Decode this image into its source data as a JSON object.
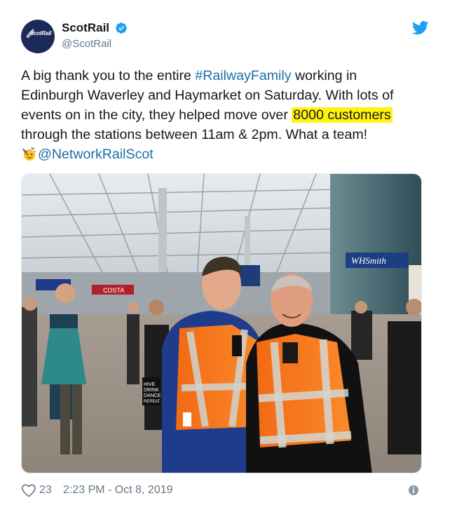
{
  "tweet": {
    "author": {
      "display_name": "ScotRail",
      "handle": "@ScotRail",
      "avatar_text": "ScotRail",
      "verified": true
    },
    "text": {
      "part1": "A big thank you to the entire ",
      "hashtag": "#RailwayFamily",
      "part2": " working in Edinburgh Waverley and Haymarket on Saturday. With lots of events on in the city, they helped move over ",
      "highlight": "8000 customers",
      "part3": " through the stations between 11am & 2pm. What a team! ",
      "mention": "@NetworkRailScot"
    },
    "photo": {
      "signs": {
        "shop": "WHSmith",
        "bag_line1": "HIVE",
        "bag_line2": "DRINK",
        "bag_line3": "DANCE",
        "bag_line4": "REPEAT",
        "costa": "COSTA"
      }
    },
    "footer": {
      "likes": "23",
      "timestamp": "2:23 PM - Oct 8, 2019"
    }
  },
  "colors": {
    "link": "#1b6fa8",
    "highlight": "#fff20d",
    "twitter_blue": "#1da1f2",
    "muted": "#657786",
    "hi_vis_orange": "#f7731e"
  },
  "icons": [
    "verified-icon",
    "twitter-bird-icon",
    "party-emoji-icon",
    "heart-icon",
    "info-icon"
  ]
}
